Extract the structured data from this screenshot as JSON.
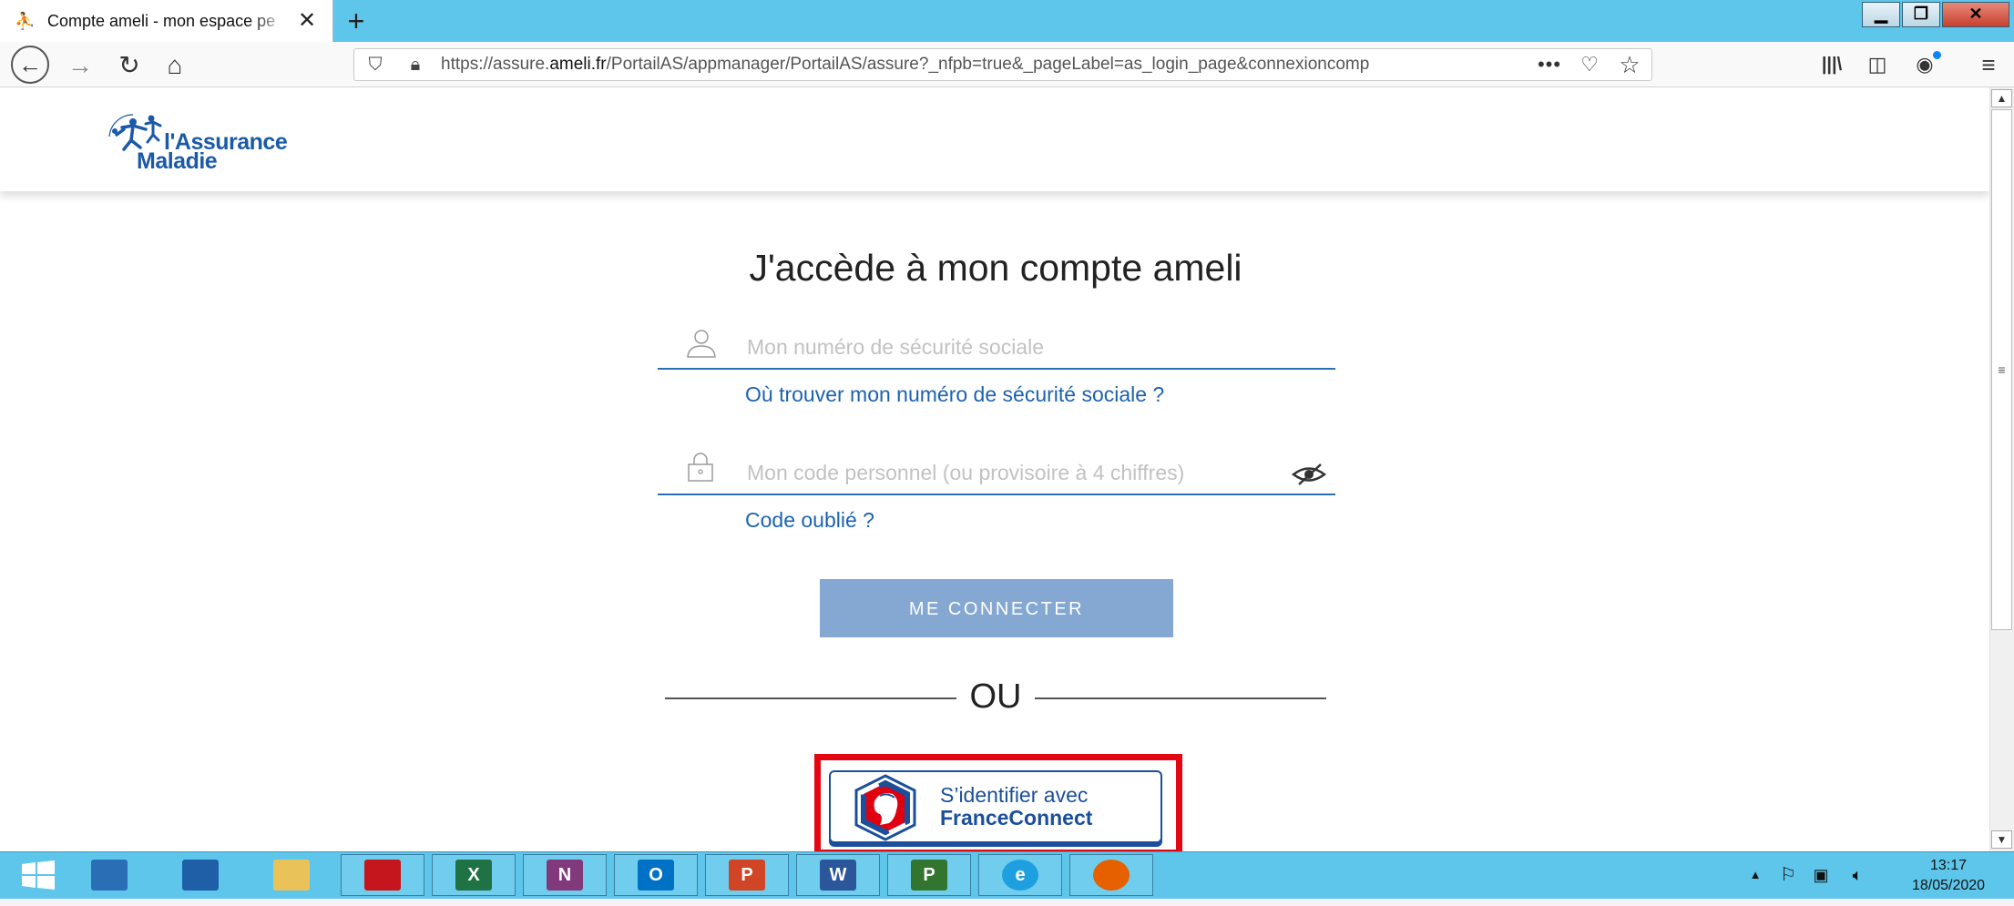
{
  "browser": {
    "tab_title": "Compte ameli - mon espace pe",
    "tab_favicon": "ameli-favicon",
    "url_prefix": "https://assure.",
    "url_domain": "ameli.fr",
    "url_path": "/PortailAS/appmanager/PortailAS/assure?_nfpb=true&_pageLabel=as_login_page&connexioncomp",
    "page_actions_glyph": "•••"
  },
  "header": {
    "logo_line1": "l'Assurance",
    "logo_line2": "Maladie"
  },
  "login": {
    "title": "J'accède à mon compte ameli",
    "ssn_placeholder": "Mon numéro de sécurité sociale",
    "ssn_help": "Où trouver mon numéro de sécurité sociale ?",
    "code_placeholder": "Mon code personnel (ou provisoire à 4 chiffres)",
    "forgot_code": "Code oublié ?",
    "connect_label": "ME CONNECTER",
    "separator": "OU",
    "franceconnect_line1": "S’identifier avec",
    "franceconnect_line2": "FranceConnect"
  },
  "taskbar": {
    "apps": [
      {
        "name": "server-manager",
        "label": "",
        "color": "#2a6fb5"
      },
      {
        "name": "powershell",
        "label": "",
        "color": "#1f5fa8"
      },
      {
        "name": "file-explorer",
        "label": "",
        "color": "#e9c25a"
      },
      {
        "name": "acrobat",
        "label": "",
        "color": "#c4161c"
      },
      {
        "name": "excel",
        "label": "X",
        "color": "#1f7244"
      },
      {
        "name": "onenote",
        "label": "N",
        "color": "#80397b"
      },
      {
        "name": "outlook",
        "label": "O",
        "color": "#0072c6"
      },
      {
        "name": "powerpoint",
        "label": "P",
        "color": "#d04525"
      },
      {
        "name": "word",
        "label": "W",
        "color": "#2b579a"
      },
      {
        "name": "project",
        "label": "P",
        "color": "#31752f"
      },
      {
        "name": "internet-explorer",
        "label": "e",
        "color": "#1ea0e0"
      },
      {
        "name": "firefox",
        "label": "",
        "color": "#e66000"
      }
    ],
    "time": "13:17",
    "date": "18/05/2020"
  }
}
